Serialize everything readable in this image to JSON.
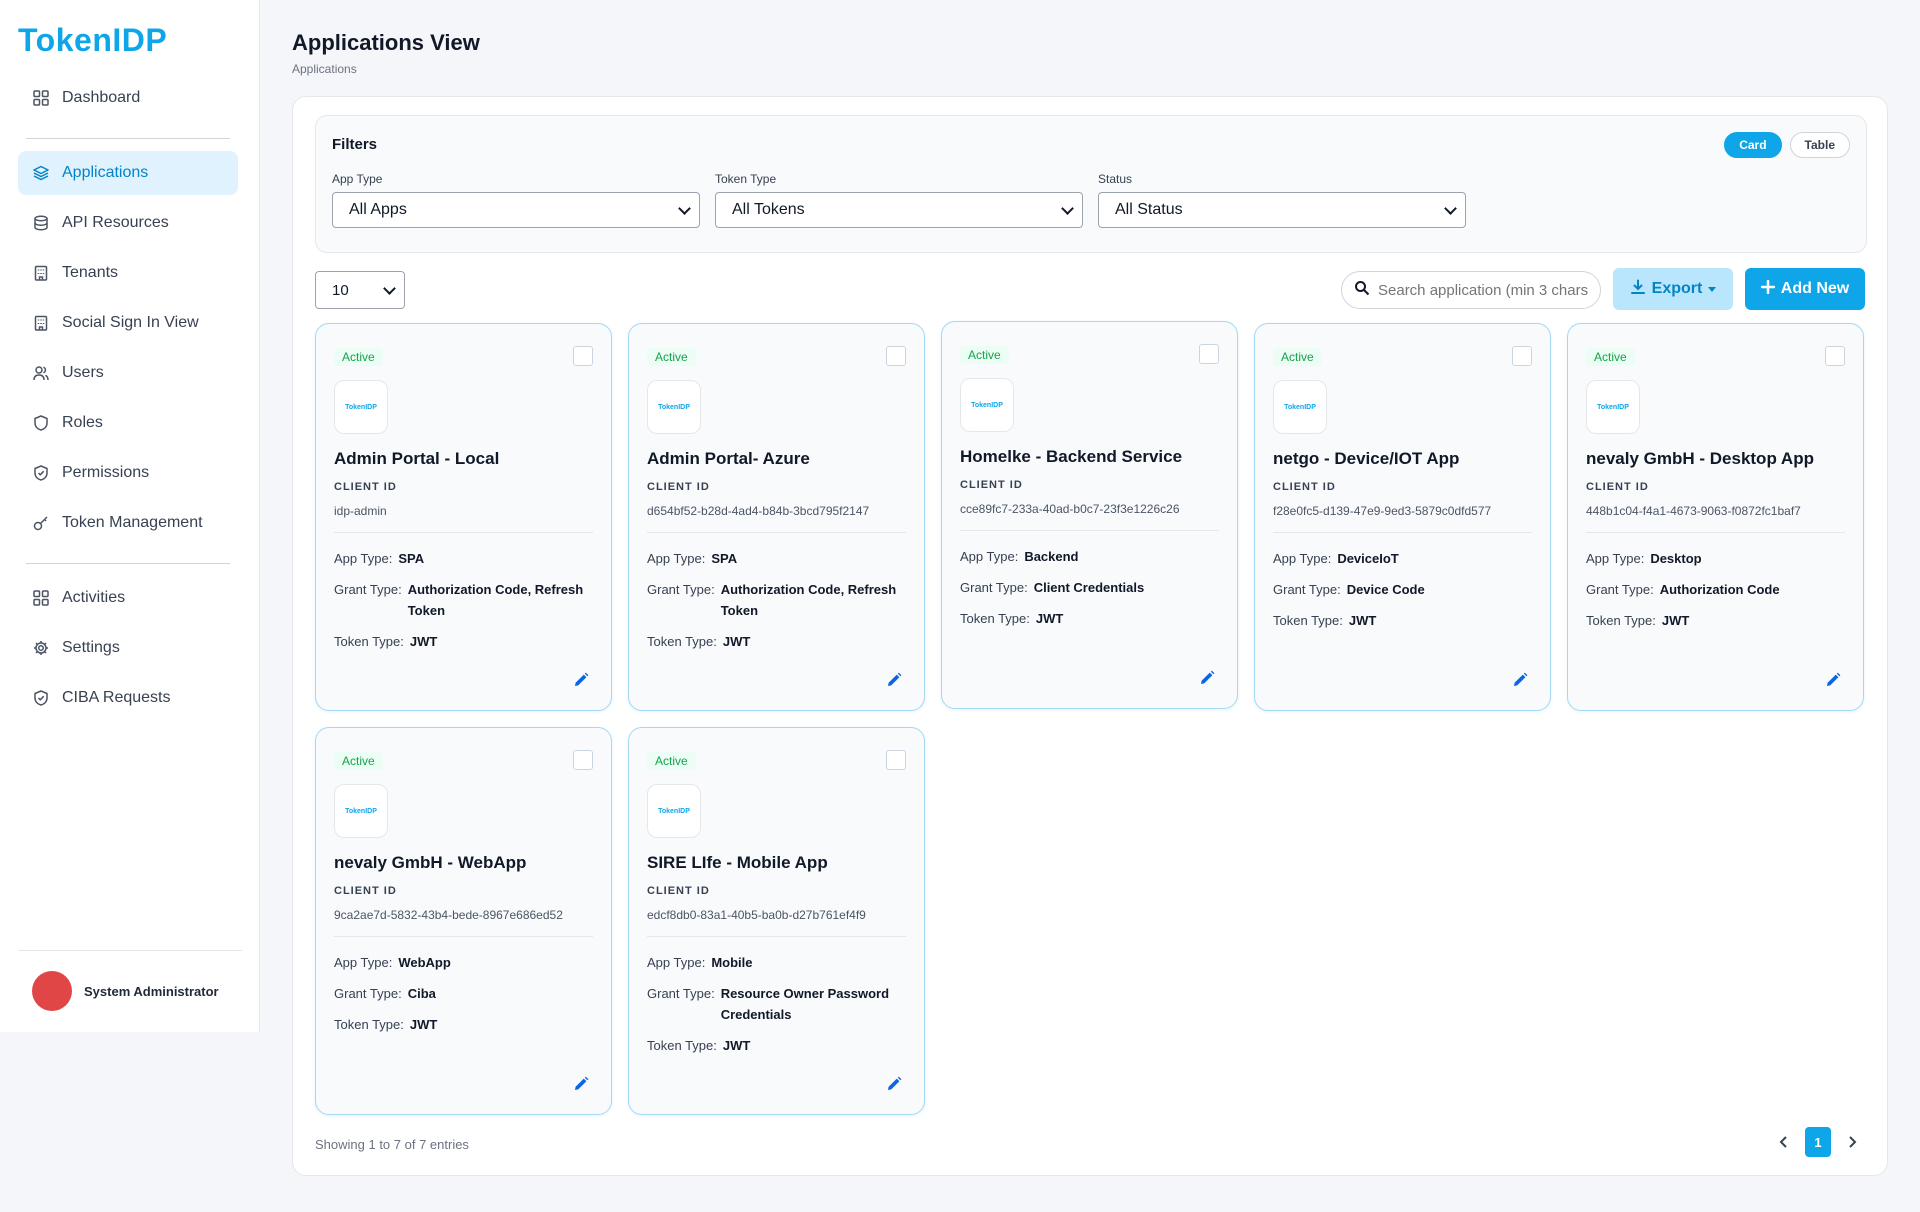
{
  "app": {
    "logo": "TokenIDP"
  },
  "sidebar": {
    "items": [
      {
        "label": "Dashboard"
      },
      {
        "label": "Applications"
      },
      {
        "label": "API Resources"
      },
      {
        "label": "Tenants"
      },
      {
        "label": "Social Sign In View"
      },
      {
        "label": "Users"
      },
      {
        "label": "Roles"
      },
      {
        "label": "Permissions"
      },
      {
        "label": "Token Management"
      },
      {
        "label": "Activities"
      },
      {
        "label": "Settings"
      },
      {
        "label": "CIBA Requests"
      }
    ],
    "user": {
      "name": "System Administrator"
    }
  },
  "header": {
    "title": "Applications View",
    "breadcrumb": "Applications"
  },
  "filters": {
    "title": "Filters",
    "view_card": "Card",
    "view_table": "Table",
    "app_type": {
      "label": "App Type",
      "value": "All Apps"
    },
    "token_type": {
      "label": "Token Type",
      "value": "All Tokens"
    },
    "status": {
      "label": "Status",
      "value": "All Status"
    }
  },
  "toolbar": {
    "page_size": "10",
    "search_placeholder": "Search application (min 3 chars)",
    "export_label": "Export",
    "add_label": "Add New"
  },
  "cards": [
    {
      "status": "Active",
      "logo": "TokenIDP",
      "name": "Admin Portal - Local",
      "client_id_label": "CLIENT ID",
      "client_id": "idp-admin",
      "app_type": "SPA",
      "grant_type": "Authorization Code, Refresh Token",
      "token_type": "JWT"
    },
    {
      "status": "Active",
      "logo": "TokenIDP",
      "name": "Admin Portal- Azure",
      "client_id_label": "CLIENT ID",
      "client_id": "d654bf52-b28d-4ad4-b84b-3bcd795f2147",
      "app_type": "SPA",
      "grant_type": "Authorization Code, Refresh Token",
      "token_type": "JWT"
    },
    {
      "status": "Active",
      "logo": "TokenIDP",
      "name": "Homelke - Backend Service",
      "client_id_label": "CLIENT ID",
      "client_id": "cce89fc7-233a-40ad-b0c7-23f3e1226c26",
      "app_type": "Backend",
      "grant_type": "Client Credentials",
      "token_type": "JWT"
    },
    {
      "status": "Active",
      "logo": "TokenIDP",
      "name": "netgo - Device/IOT App",
      "client_id_label": "CLIENT ID",
      "client_id": "f28e0fc5-d139-47e9-9ed3-5879c0dfd577",
      "app_type": "DeviceIoT",
      "grant_type": "Device Code",
      "token_type": "JWT"
    },
    {
      "status": "Active",
      "logo": "TokenIDP",
      "name": "nevaly GmbH - Desktop App",
      "client_id_label": "CLIENT ID",
      "client_id": "448b1c04-f4a1-4673-9063-f0872fc1baf7",
      "app_type": "Desktop",
      "grant_type": "Authorization Code",
      "token_type": "JWT"
    },
    {
      "status": "Active",
      "logo": "TokenIDP",
      "name": "nevaly GmbH - WebApp",
      "client_id_label": "CLIENT ID",
      "client_id": "9ca2ae7d-5832-43b4-bede-8967e686ed52",
      "app_type": "WebApp",
      "grant_type": "Ciba",
      "token_type": "JWT"
    },
    {
      "status": "Active",
      "logo": "TokenIDP",
      "name": "SIRE LIfe - Mobile App",
      "client_id_label": "CLIENT ID",
      "client_id": "edcf8db0-83a1-40b5-ba0b-d27b761ef4f9",
      "app_type": "Mobile",
      "grant_type": "Resource Owner Password Credentials",
      "token_type": "JWT"
    }
  ],
  "labels": {
    "app_type": "App Type:",
    "grant_type": "Grant Type:",
    "token_type": "Token Type:"
  },
  "footer": {
    "entries": "Showing 1 to 7 of 7 entries",
    "page": "1"
  }
}
